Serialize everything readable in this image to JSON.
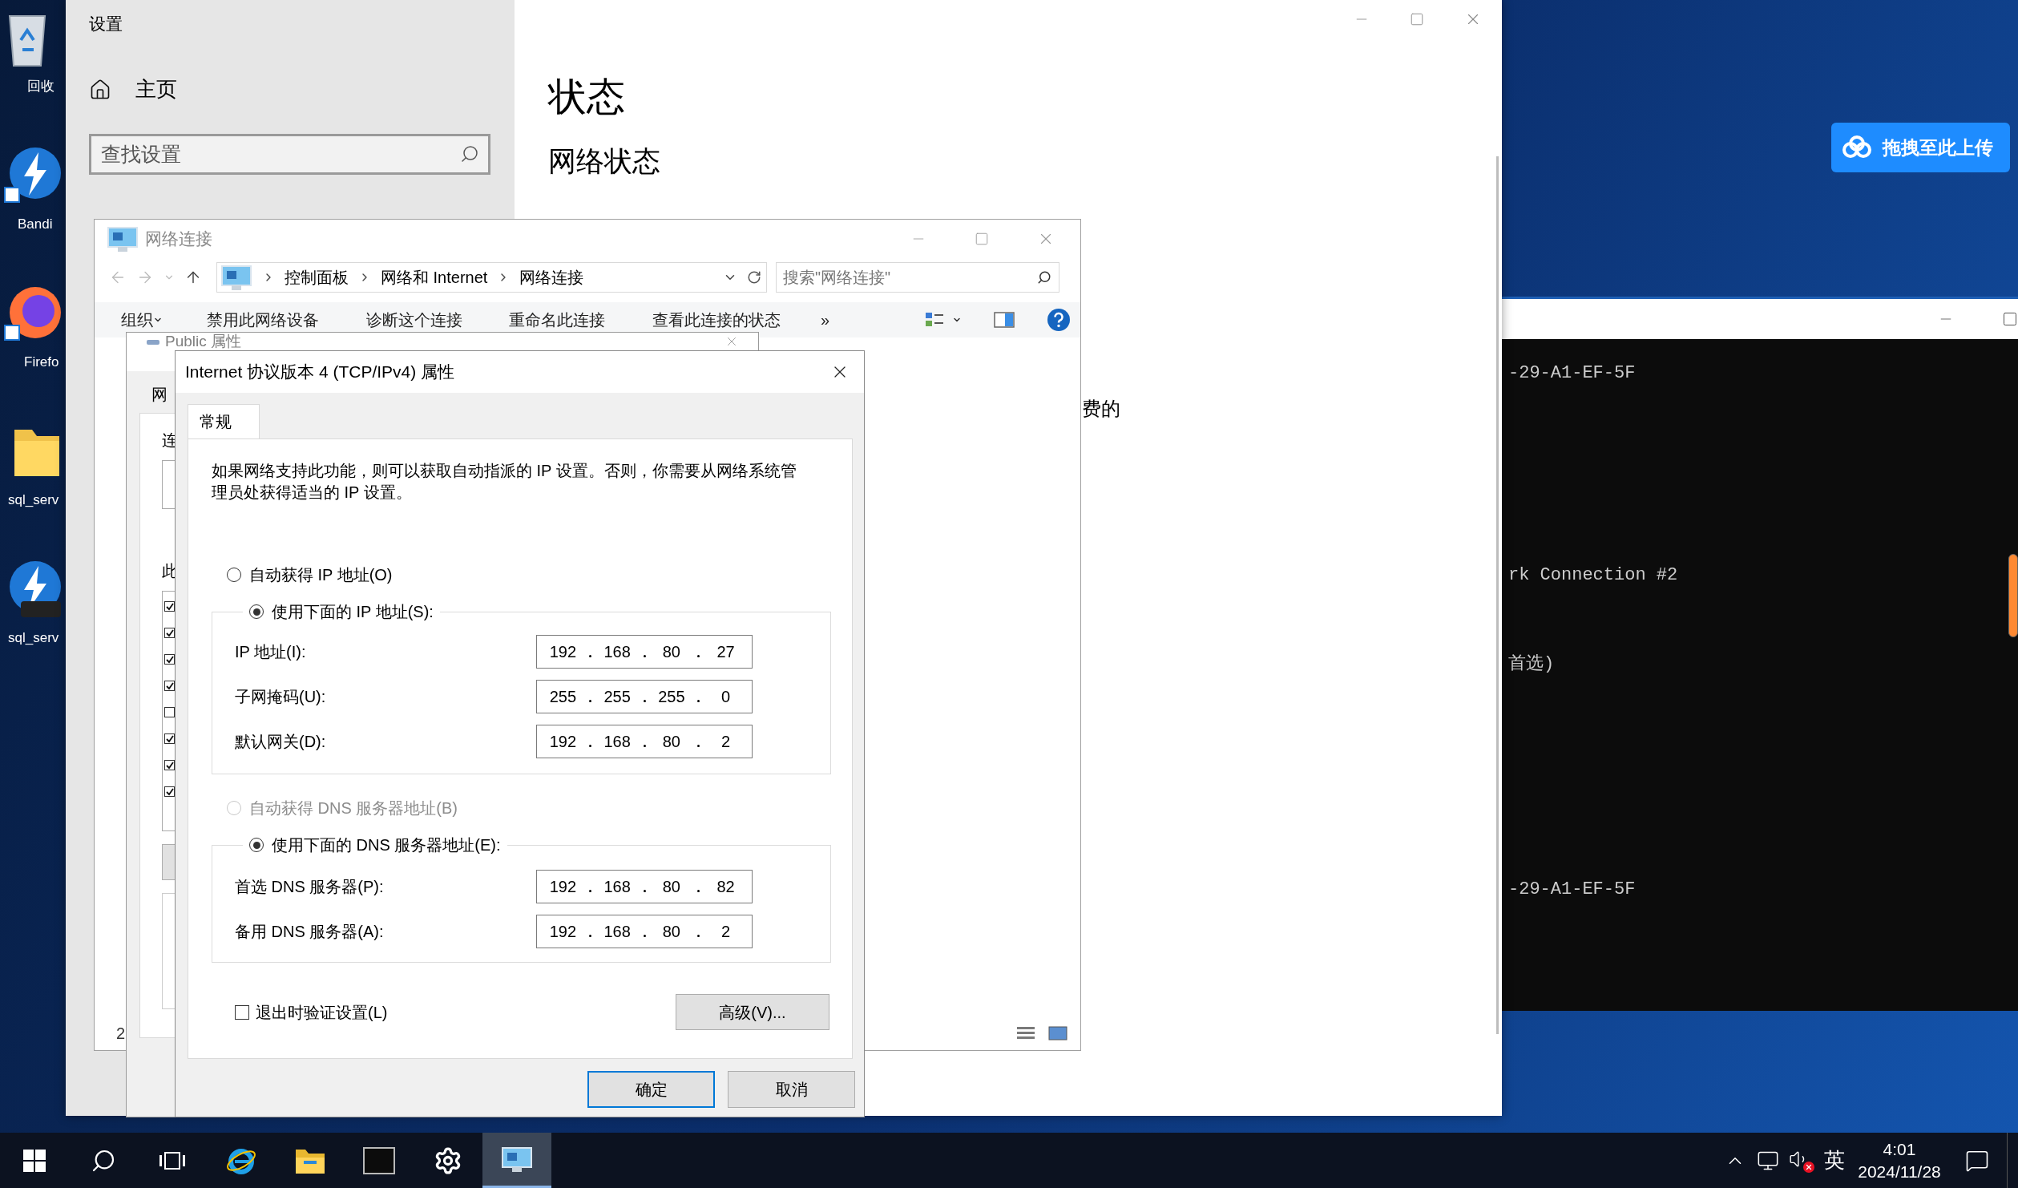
{
  "desktop_icons": [
    {
      "kind": "recycle_bin",
      "label": "回收"
    },
    {
      "kind": "bandizip",
      "label": "Bandi"
    },
    {
      "kind": "firefox",
      "label": "Firefo"
    },
    {
      "kind": "folder",
      "label": "sql_serv"
    },
    {
      "kind": "zip",
      "label": "sql_serv"
    }
  ],
  "settings": {
    "title": "设置",
    "home": "主页",
    "search": {
      "placeholder": "查找设置"
    },
    "heading": "状态",
    "subheading": "网络状态",
    "fragment": "费的"
  },
  "upload_button": {
    "label": "拖拽至此上传"
  },
  "console": {
    "lines": [
      "-29-A1-EF-5F",
      "rk Connection #2",
      "首选)",
      "-29-A1-EF-5F"
    ]
  },
  "network_window": {
    "title": "网络连接",
    "breadcrumb": [
      "控制面板",
      "网络和 Internet",
      "网络连接"
    ],
    "search": {
      "placeholder": "搜索\"网络连接\""
    },
    "toolbar": [
      {
        "label": "组织",
        "kind": "menu"
      },
      {
        "label": "禁用此网络设备",
        "kind": "command"
      },
      {
        "label": "诊断这个连接",
        "kind": "command"
      },
      {
        "label": "重命名此连接",
        "kind": "command"
      },
      {
        "label": "查看此连接的状态",
        "kind": "command"
      },
      {
        "label": "»",
        "kind": "more"
      }
    ],
    "status": "2"
  },
  "public_window": {
    "title": "Public 属性",
    "tab": "网",
    "labels": [
      "连",
      "此"
    ],
    "components": [
      {
        "checked": true
      },
      {
        "checked": true
      },
      {
        "checked": true
      },
      {
        "checked": true
      },
      {
        "checked": false
      },
      {
        "checked": true
      },
      {
        "checked": true
      },
      {
        "checked": true
      }
    ]
  },
  "tcp_dialog": {
    "title": "Internet 协议版本 4 (TCP/IPv4) 属性",
    "tab": "常规",
    "description": "如果网络支持此功能，则可以获取自动指派的 IP 设置。否则，你需要从网络系统管理员处获得适当的 IP 设置。",
    "ip_options": [
      {
        "label": "自动获得 IP 地址(O)",
        "selected": false,
        "disabled": false
      },
      {
        "label": "使用下面的 IP 地址(S):",
        "selected": true,
        "disabled": false
      }
    ],
    "ip_fields": [
      {
        "label": "IP 地址(I):",
        "octets": [
          "192",
          "168",
          "80",
          "27"
        ]
      },
      {
        "label": "子网掩码(U):",
        "octets": [
          "255",
          "255",
          "255",
          "0"
        ]
      },
      {
        "label": "默认网关(D):",
        "octets": [
          "192",
          "168",
          "80",
          "2"
        ]
      }
    ],
    "dns_options": [
      {
        "label": "自动获得 DNS 服务器地址(B)",
        "selected": false,
        "disabled": true
      },
      {
        "label": "使用下面的 DNS 服务器地址(E):",
        "selected": true,
        "disabled": false
      }
    ],
    "dns_fields": [
      {
        "label": "首选 DNS 服务器(P):",
        "octets": [
          "192",
          "168",
          "80",
          "82"
        ]
      },
      {
        "label": "备用 DNS 服务器(A):",
        "octets": [
          "192",
          "168",
          "80",
          "2"
        ]
      }
    ],
    "validate": {
      "label": "退出时验证设置(L)",
      "checked": false
    },
    "advanced_button": "高级(V)...",
    "ok_button": "确定",
    "cancel_button": "取消"
  },
  "taskbar": {
    "apps": [
      {
        "kind": "ie",
        "selected": false
      },
      {
        "kind": "explorer",
        "selected": false
      },
      {
        "kind": "cmd",
        "selected": false
      },
      {
        "kind": "settings",
        "selected": false
      },
      {
        "kind": "network",
        "selected": true
      }
    ],
    "ime": "英",
    "time": "4:01",
    "date": "2024/11/28"
  }
}
